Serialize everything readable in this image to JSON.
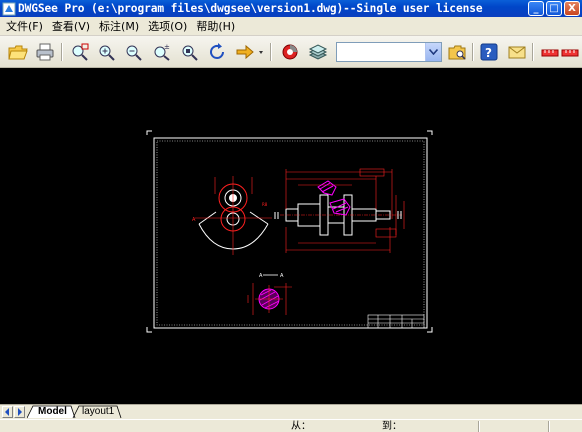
{
  "window": {
    "title": "DWGSee Pro (e:\\program files\\dwgsee\\version1.dwg)--Single user license",
    "minimize_label": "_",
    "maximize_label": "□",
    "close_label": "X"
  },
  "menu": {
    "items": [
      {
        "label": "文件(F)"
      },
      {
        "label": "查看(V)"
      },
      {
        "label": "标注(M)"
      },
      {
        "label": "选项(O)"
      },
      {
        "label": "帮助(H)"
      }
    ]
  },
  "toolbar": {
    "layer_combo_value": "",
    "icons": [
      "open-folder-icon",
      "print-icon",
      "zoom-window-icon",
      "zoom-in-icon",
      "zoom-out-icon",
      "zoom-realtime-icon",
      "zoom-extents-icon",
      "rotate-icon",
      "next-arrow-icon",
      "render-icon",
      "layers-icon",
      "folder-search-icon",
      "help-icon",
      "email-icon",
      "measure-icon"
    ]
  },
  "tabs": {
    "items": [
      {
        "label": "Model"
      },
      {
        "label": "layout1"
      }
    ],
    "active": "Model"
  },
  "statusbar": {
    "from_label": "从：",
    "to_label": "到："
  },
  "colors": {
    "titlebar": "#0a52d4",
    "chrome": "#ece9d8",
    "canvas": "#000000",
    "drawing_lines": "#ffffff",
    "drawing_red": "#ff0000",
    "drawing_magenta": "#ff00ff"
  }
}
